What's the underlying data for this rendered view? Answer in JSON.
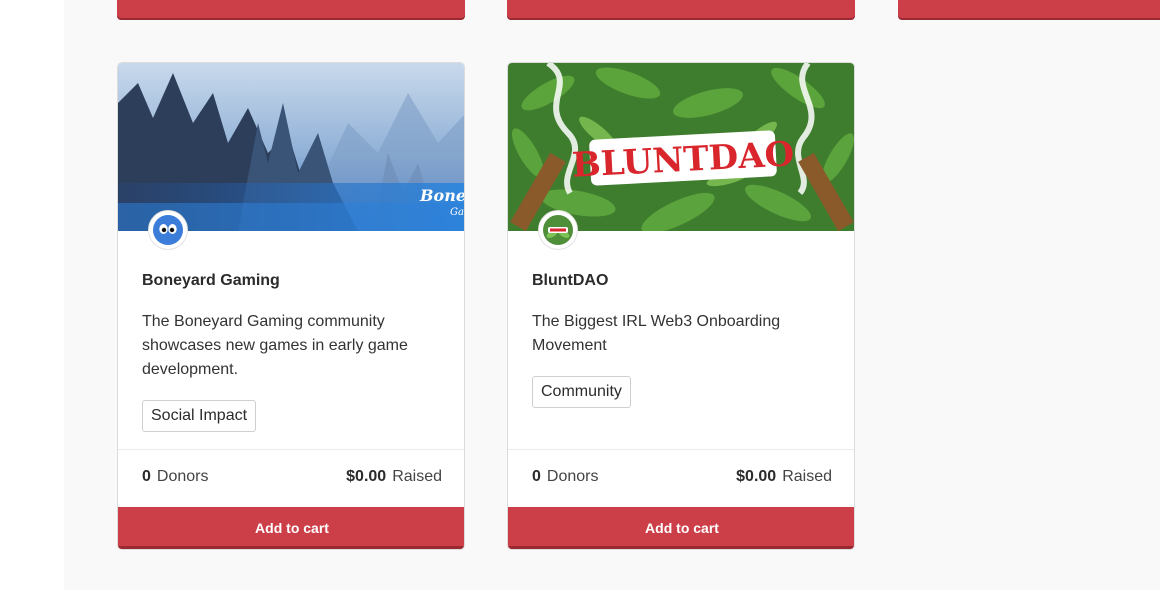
{
  "cards": [
    {
      "title": "Boneyard Gaming",
      "description": "The Boneyard Gaming community showcases new games in early game development.",
      "tag": "Social Impact",
      "donors_count": "0",
      "donors_label": "Donors",
      "raised_amount": "$0.00",
      "raised_label": "Raised",
      "button_label": "Add to cart",
      "banner_text": "BoneY",
      "banner_subtext": "Ga"
    },
    {
      "title": "BluntDAO",
      "description": "The Biggest IRL Web3 Onboarding Movement",
      "tag": "Community",
      "donors_count": "0",
      "donors_label": "Donors",
      "raised_amount": "$0.00",
      "raised_label": "Raised",
      "button_label": "Add to cart",
      "banner_text": "BLUNTDAO"
    }
  ],
  "colors": {
    "accent": "#cc3f48",
    "page_background": "#f9f9f9"
  }
}
